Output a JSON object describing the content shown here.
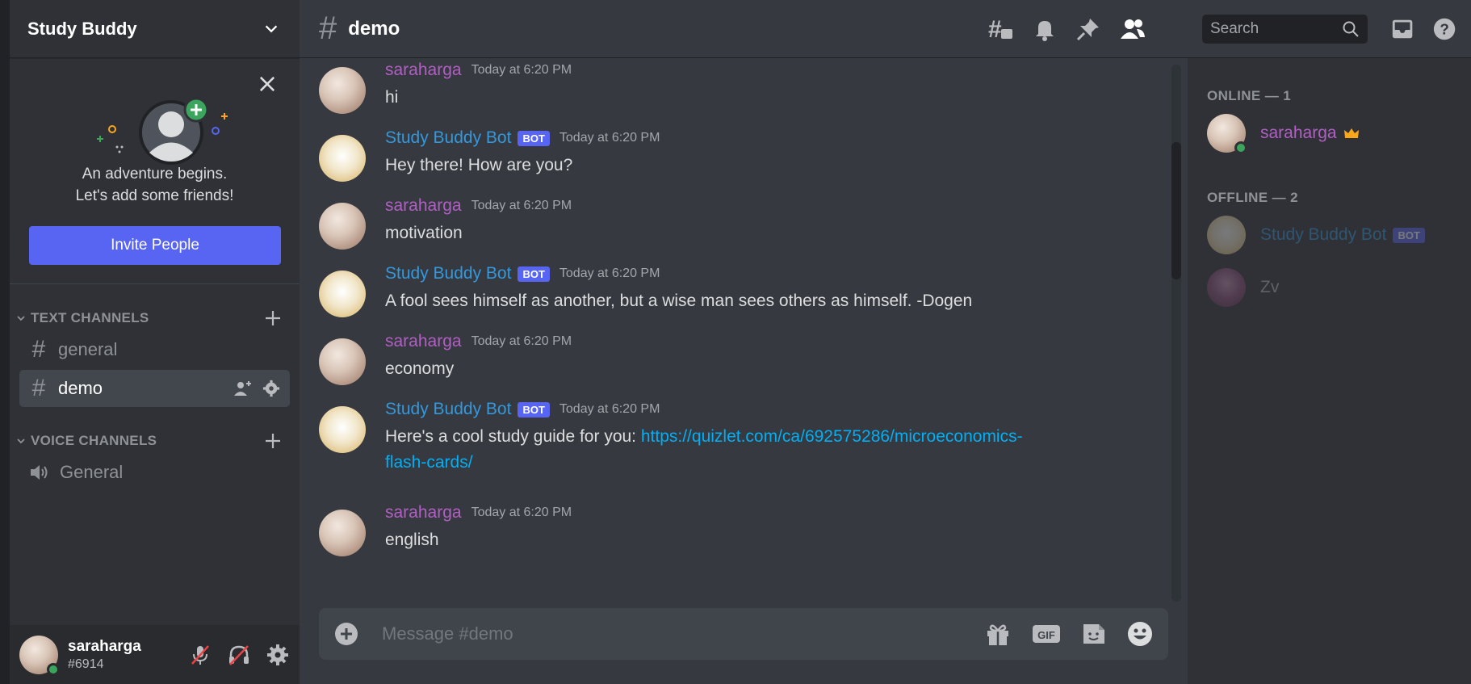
{
  "server": {
    "name": "Study Buddy"
  },
  "invite": {
    "line1": "An adventure begins.",
    "line2": "Let's add some friends!",
    "button": "Invite People"
  },
  "categories": {
    "text": "TEXT CHANNELS",
    "voice": "VOICE CHANNELS"
  },
  "channels": {
    "general": "general",
    "demo": "demo",
    "voice_general": "General"
  },
  "user": {
    "name": "saraharga",
    "tag": "#6914"
  },
  "chat": {
    "title": "demo",
    "placeholder": "Message #demo"
  },
  "messages": [
    {
      "author": "saraharga",
      "time": "Today at 6:20 PM",
      "text": "hi"
    },
    {
      "author": "Study Buddy Bot",
      "bot": "BOT",
      "time": "Today at 6:20 PM",
      "text": "Hey there! How are you?"
    },
    {
      "author": "saraharga",
      "time": "Today at 6:20 PM",
      "text": "motivation"
    },
    {
      "author": "Study Buddy Bot",
      "bot": "BOT",
      "time": "Today at 6:20 PM",
      "text": "A fool sees himself as another, but a wise man sees others as himself. -Dogen"
    },
    {
      "author": "saraharga",
      "time": "Today at 6:20 PM",
      "text": "economy"
    },
    {
      "author": "Study Buddy Bot",
      "bot": "BOT",
      "time": "Today at 6:20 PM",
      "text": "Here's a cool study guide for you: ",
      "link1": "https://quizlet.com/ca/692575286/microeconomics-",
      "link2": "flash-cards/"
    },
    {
      "author": "saraharga",
      "time": "Today at 6:20 PM",
      "text": "english"
    }
  ],
  "header": {
    "search_placeholder": "Search"
  },
  "composer": {
    "gif": "GIF"
  },
  "members": {
    "online_header": "ONLINE — 1",
    "offline_header": "OFFLINE — 2",
    "online": [
      {
        "name": "saraharga"
      }
    ],
    "offline": [
      {
        "name": "Study Buddy Bot",
        "bot": "BOT"
      },
      {
        "name": "Zv"
      }
    ]
  },
  "colors": {
    "blurple": "#5865f2",
    "online": "#3ba55d",
    "owner_crown": "#faa81a",
    "sara_role": "#b25fc5",
    "bot_role": "#3498db",
    "link": "#00aff4"
  },
  "icons": [
    "chevron-down-icon",
    "close-icon",
    "hash-icon",
    "plus-icon",
    "speaker-icon",
    "add-member-icon",
    "gear-icon",
    "mic-muted-icon",
    "headphones-muted-icon",
    "threads-icon",
    "bell-icon",
    "pin-icon",
    "members-icon",
    "search-icon",
    "inbox-icon",
    "help-icon",
    "gift-icon",
    "gif-icon",
    "sticker-icon",
    "emoji-icon",
    "crown-icon",
    "add-circle-icon"
  ]
}
